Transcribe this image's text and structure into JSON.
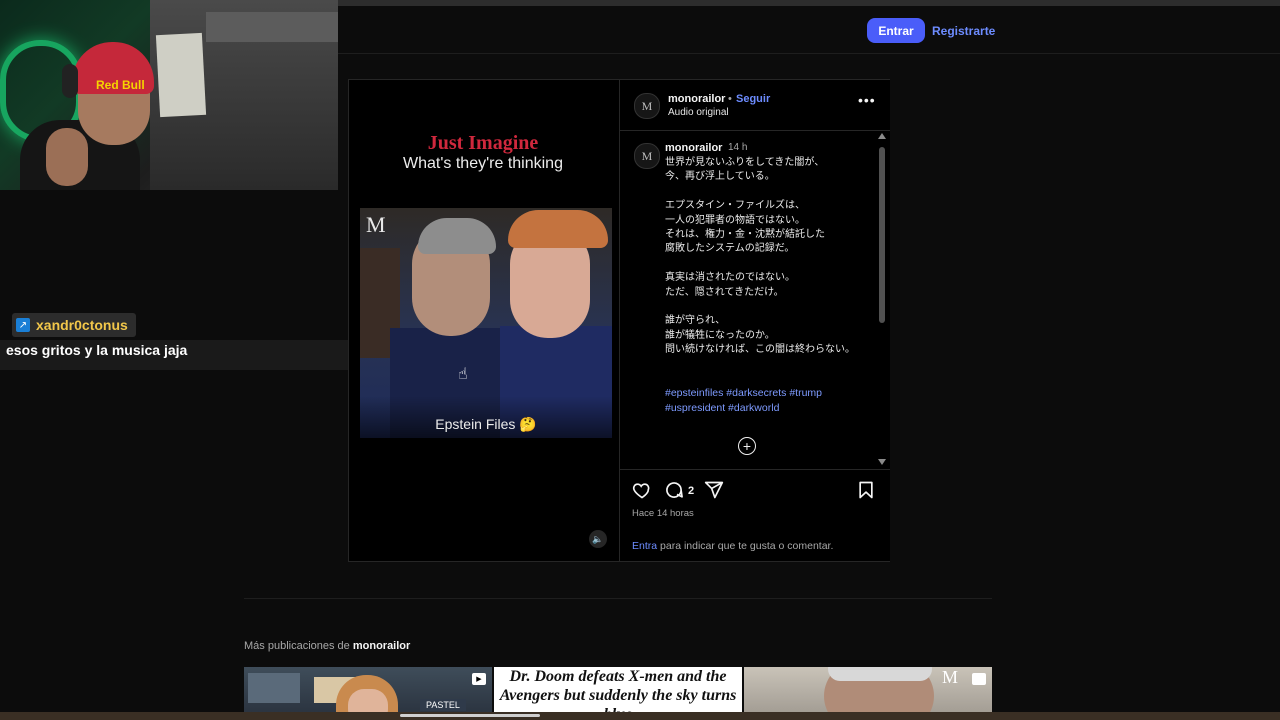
{
  "header": {
    "login_label": "Entrar",
    "register_label": "Registrarte"
  },
  "overlay": {
    "webcam_cap_text": "Red Bull",
    "chat": {
      "username": "xandr0ctonus",
      "message": "esos gritos y la musica jaja"
    }
  },
  "post": {
    "media": {
      "title_red": "Just Imagine",
      "title_white": "What's they're thinking",
      "watermark": "M",
      "caption": "Epstein Files 🤔",
      "mute_icon": "speaker-icon"
    },
    "header": {
      "avatar_letter": "M",
      "username": "monorailor",
      "separator": "•",
      "follow_label": "Seguir",
      "audio_label": "Audio original",
      "more_icon": "•••"
    },
    "caption": {
      "avatar_letter": "M",
      "username": "monorailor",
      "time": "14 h",
      "text": "世界が見ないふりをしてきた闇が、\n今、再び浮上している。\n\nエプスタイン・ファイルズは、\n一人の犯罪者の物語ではない。\nそれは、権力・金・沈黙が結託した\n腐敗したシステムの記録だ。\n\n真実は消されたのではない。\nただ、隠されてきただけ。\n\n誰が守られ、\n誰が犠牲になったのか。\n問い続けなければ、この闇は終わらない。",
      "hashtags": [
        "#epsteinfiles",
        "#darksecrets",
        "#trump",
        "#uspresident",
        "#darkworld"
      ]
    },
    "actions": {
      "comment_count": "2",
      "posted_ago": "Hace 14 horas",
      "login_link": "Entra",
      "login_prompt": " para indicar que te gusta o comentar."
    }
  },
  "more_posts": {
    "prefix": "Más publicaciones de ",
    "username": "monorailor",
    "thumb1_sign": "PASTEL",
    "thumb2_text": "Dr. Doom defeats X-men and the Avengers but suddenly the sky turns blue",
    "thumb3_watermark": "M"
  },
  "colors": {
    "accent_blue": "#4a5df9",
    "link_blue": "#6d8cff",
    "hashtag_blue": "#7e9bff",
    "title_red": "#d0283d"
  }
}
